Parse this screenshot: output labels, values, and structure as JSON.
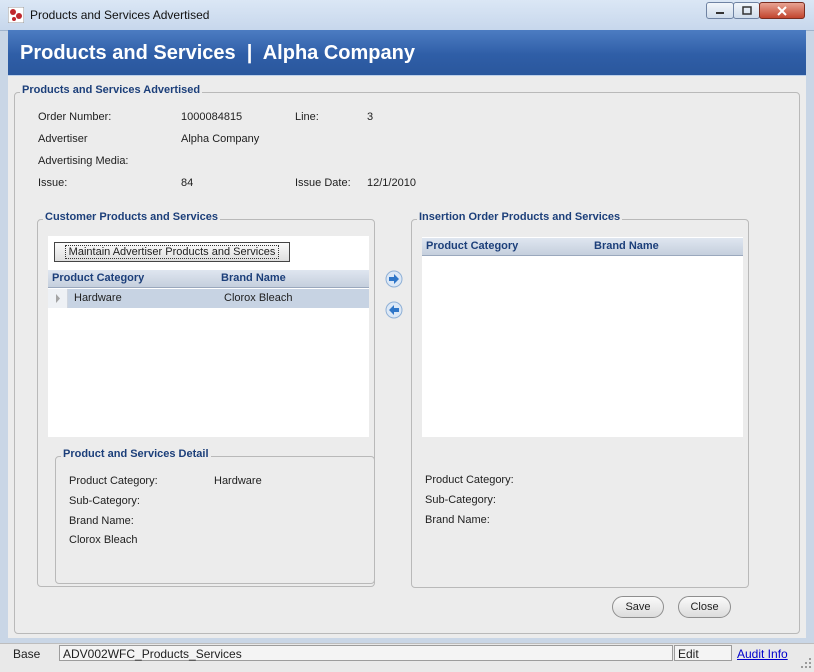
{
  "window": {
    "title": "Products and Services Advertised"
  },
  "header": {
    "title": "Products and Services  |  Alpha Company"
  },
  "advertised": {
    "legend": "Products and Services Advertised",
    "order_number_label": "Order Number:",
    "order_number": "1000084815",
    "line_label": "Line:",
    "line": "3",
    "advertiser_label": "Advertiser",
    "advertiser": "Alpha Company",
    "media_label": "Advertising Media:",
    "issue_label": "Issue:",
    "issue": "84",
    "issue_date_label": "Issue Date:",
    "issue_date": "12/1/2010"
  },
  "customer": {
    "legend": "Customer Products and Services",
    "maintain_button": "Maintain Advertiser Products and Services",
    "columns": [
      "Product Category",
      "Brand Name"
    ],
    "rows": [
      {
        "category": "Hardware",
        "brand": "Clorox Bleach"
      }
    ]
  },
  "detail": {
    "legend": "Product and Services Detail",
    "category_label": "Product Category:",
    "category": "Hardware",
    "subcategory_label": "Sub-Category:",
    "brand_label": "Brand Name:",
    "brand": "Clorox Bleach"
  },
  "insertion": {
    "legend": "Insertion Order Products and Services",
    "columns": [
      "Product Category",
      "Brand Name"
    ],
    "category_label": "Product Category:",
    "subcategory_label": "Sub-Category:",
    "brand_label": "Brand Name:"
  },
  "buttons": {
    "save": "Save",
    "close": "Close"
  },
  "status": {
    "mode": "Base",
    "form": "ADV002WFC_Products_Services",
    "state": "Edit",
    "audit": "Audit Info"
  },
  "colors": {
    "header": "#2f5ea7",
    "legend": "#1c3f7a",
    "link": "#0000cc"
  }
}
